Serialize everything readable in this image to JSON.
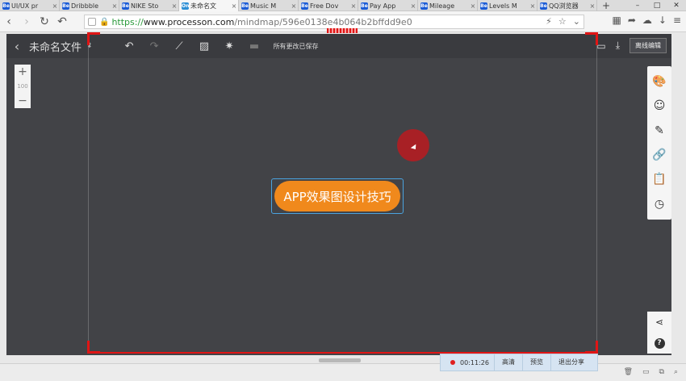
{
  "browser": {
    "tabs": [
      {
        "label": "UI/UX pr",
        "icon": "Be"
      },
      {
        "label": "Dribbble",
        "icon": "Be"
      },
      {
        "label": "NIKE Sto",
        "icon": "Be"
      },
      {
        "label": "未命名文",
        "icon": "On",
        "active": true
      },
      {
        "label": "Music M",
        "icon": "Be"
      },
      {
        "label": "Free Dov",
        "icon": "Be"
      },
      {
        "label": "Pay App",
        "icon": "Be"
      },
      {
        "label": "Mileage",
        "icon": "Be"
      },
      {
        "label": "Levels M",
        "icon": "Be"
      },
      {
        "label": "QQ浏览器",
        "icon": "Be"
      }
    ],
    "url_protocol": "https://",
    "url_host": "www.processon.com",
    "url_path": "/mindmap/596e0138e4b064b2bffdd9e0"
  },
  "app_toolbar": {
    "file_name": "未命名文件",
    "save_status": "所有更改已保存",
    "offline_edit_label": "离线编辑"
  },
  "canvas": {
    "zoom_level": "100",
    "central_node_text": "APP效果图设计技巧"
  },
  "recording_bar": {
    "elapsed": "00:11:26",
    "hd_label": "高清",
    "preview_label": "预览",
    "exit_share_label": "退出分享"
  },
  "colors": {
    "canvas_bg": "#424347",
    "node_fill": "#f0891c",
    "selection_border": "#4aa3df",
    "frame_red": "#e01515"
  }
}
